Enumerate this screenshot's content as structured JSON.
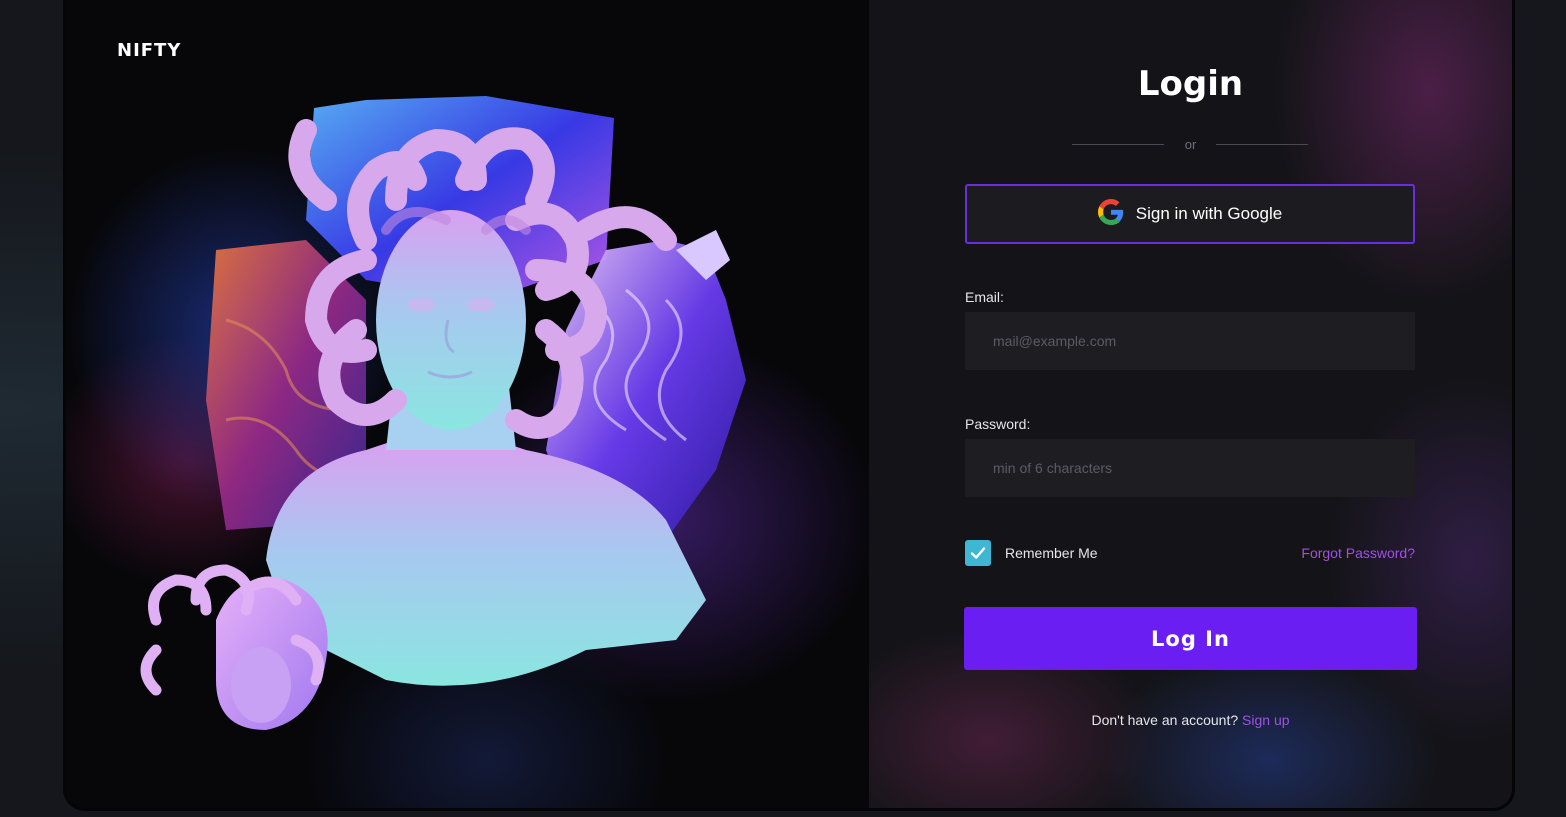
{
  "brand": {
    "name": "NIFTY"
  },
  "login": {
    "title": "Login",
    "divider_text": "or",
    "google_button": {
      "label": "Sign in with Google",
      "icon": "google-icon"
    },
    "email": {
      "label": "Email:",
      "placeholder": "mail@example.com",
      "value": ""
    },
    "password": {
      "label": "Password:",
      "placeholder": "min of 6 characters",
      "value": ""
    },
    "remember_me": {
      "label": "Remember Me",
      "checked": true
    },
    "forgot_password": "Forgot Password?",
    "submit_label": "Log In",
    "signup_prompt": "Don't have an account?",
    "signup_link": "Sign up"
  },
  "colors": {
    "accent": "#6b1ef2",
    "link": "#a050e6",
    "checkbox": "#3fb6d2",
    "panel_bg": "#141418"
  }
}
